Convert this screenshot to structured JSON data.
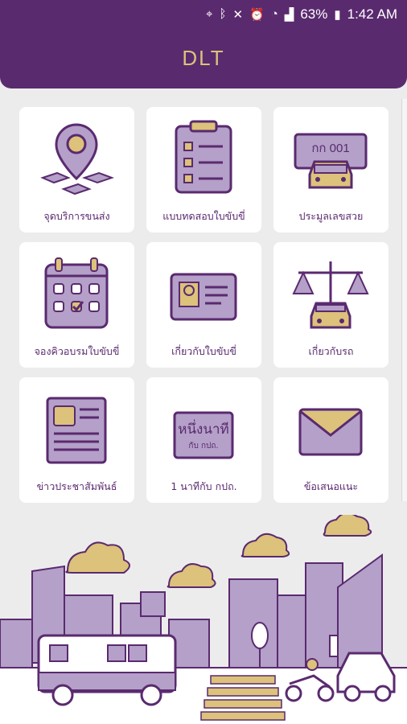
{
  "status": {
    "battery": "63%",
    "time": "1:42 AM"
  },
  "appbar": {
    "title": "DLT"
  },
  "menu": [
    {
      "label": "จุดบริการขนส่ง",
      "icon": "location-pin-icon"
    },
    {
      "label": "แบบทดสอบใบขับขี่",
      "icon": "clipboard-checklist-icon"
    },
    {
      "label": "ประมูลเลขสวย",
      "icon": "license-plate-car-icon"
    },
    {
      "label": "จองคิวอบรมใบขับขี่",
      "icon": "calendar-check-icon"
    },
    {
      "label": "เกี่ยวกับใบขับขี่",
      "icon": "id-card-icon"
    },
    {
      "label": "เกี่ยวกับรถ",
      "icon": "scale-car-icon"
    },
    {
      "label": "ข่าวประชาสัมพันธ์",
      "icon": "newspaper-icon"
    },
    {
      "label": "1 นาทีกับ กปถ.",
      "icon": "one-minute-badge-icon",
      "badge_main": "หนึ่งนาที",
      "badge_sub": "กับ กปถ."
    },
    {
      "label": "ข้อเสนอแนะ",
      "icon": "envelope-icon"
    }
  ],
  "plate": {
    "text": "กก 001"
  },
  "colors": {
    "primary": "#5a2a6f",
    "accent": "#dcc27a",
    "light": "#b4a0c8"
  }
}
